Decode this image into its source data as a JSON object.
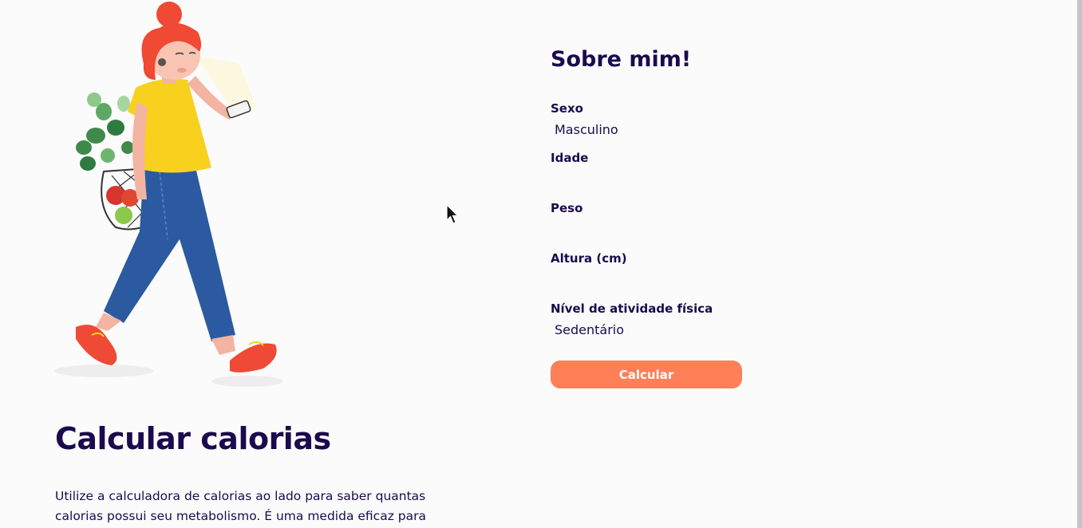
{
  "hero": {
    "title": "Calcular calorias",
    "description": "Utilize a calculadora de calorias ao lado para saber quantas calorias possui seu metabolismo. É uma medida eficaz para"
  },
  "form": {
    "title": "Sobre mim!",
    "fields": [
      {
        "label": "Sexo",
        "value": "Masculino"
      },
      {
        "label": "Idade",
        "value": ""
      },
      {
        "label": "Peso",
        "value": ""
      },
      {
        "label": "Altura (cm)",
        "value": ""
      },
      {
        "label": "Nível de atividade física",
        "value": "Sedentário"
      }
    ],
    "button_label": "Calcular"
  },
  "colors": {
    "text": "#1a0b4f",
    "accent": "#ff7f57",
    "background": "#fcfbfb"
  },
  "icons": {
    "illustration": "woman-walking-with-groceries-illustration",
    "cursor": "mouse-pointer-icon"
  }
}
